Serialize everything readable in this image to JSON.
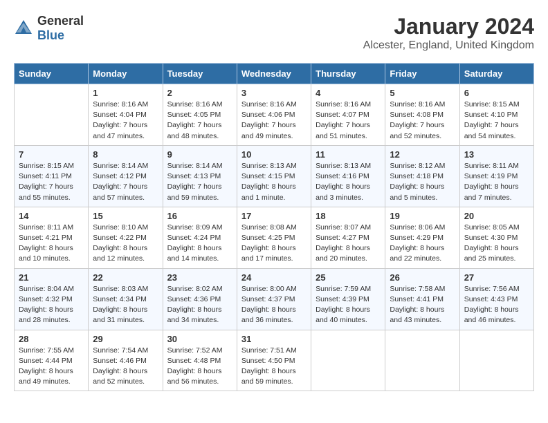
{
  "header": {
    "logo_general": "General",
    "logo_blue": "Blue",
    "month_title": "January 2024",
    "location": "Alcester, England, United Kingdom"
  },
  "days_of_week": [
    "Sunday",
    "Monday",
    "Tuesday",
    "Wednesday",
    "Thursday",
    "Friday",
    "Saturday"
  ],
  "weeks": [
    [
      {
        "day": "",
        "content": ""
      },
      {
        "day": "1",
        "content": "Sunrise: 8:16 AM\nSunset: 4:04 PM\nDaylight: 7 hours\nand 47 minutes."
      },
      {
        "day": "2",
        "content": "Sunrise: 8:16 AM\nSunset: 4:05 PM\nDaylight: 7 hours\nand 48 minutes."
      },
      {
        "day": "3",
        "content": "Sunrise: 8:16 AM\nSunset: 4:06 PM\nDaylight: 7 hours\nand 49 minutes."
      },
      {
        "day": "4",
        "content": "Sunrise: 8:16 AM\nSunset: 4:07 PM\nDaylight: 7 hours\nand 51 minutes."
      },
      {
        "day": "5",
        "content": "Sunrise: 8:16 AM\nSunset: 4:08 PM\nDaylight: 7 hours\nand 52 minutes."
      },
      {
        "day": "6",
        "content": "Sunrise: 8:15 AM\nSunset: 4:10 PM\nDaylight: 7 hours\nand 54 minutes."
      }
    ],
    [
      {
        "day": "7",
        "content": "Sunrise: 8:15 AM\nSunset: 4:11 PM\nDaylight: 7 hours\nand 55 minutes."
      },
      {
        "day": "8",
        "content": "Sunrise: 8:14 AM\nSunset: 4:12 PM\nDaylight: 7 hours\nand 57 minutes."
      },
      {
        "day": "9",
        "content": "Sunrise: 8:14 AM\nSunset: 4:13 PM\nDaylight: 7 hours\nand 59 minutes."
      },
      {
        "day": "10",
        "content": "Sunrise: 8:13 AM\nSunset: 4:15 PM\nDaylight: 8 hours\nand 1 minute."
      },
      {
        "day": "11",
        "content": "Sunrise: 8:13 AM\nSunset: 4:16 PM\nDaylight: 8 hours\nand 3 minutes."
      },
      {
        "day": "12",
        "content": "Sunrise: 8:12 AM\nSunset: 4:18 PM\nDaylight: 8 hours\nand 5 minutes."
      },
      {
        "day": "13",
        "content": "Sunrise: 8:11 AM\nSunset: 4:19 PM\nDaylight: 8 hours\nand 7 minutes."
      }
    ],
    [
      {
        "day": "14",
        "content": "Sunrise: 8:11 AM\nSunset: 4:21 PM\nDaylight: 8 hours\nand 10 minutes."
      },
      {
        "day": "15",
        "content": "Sunrise: 8:10 AM\nSunset: 4:22 PM\nDaylight: 8 hours\nand 12 minutes."
      },
      {
        "day": "16",
        "content": "Sunrise: 8:09 AM\nSunset: 4:24 PM\nDaylight: 8 hours\nand 14 minutes."
      },
      {
        "day": "17",
        "content": "Sunrise: 8:08 AM\nSunset: 4:25 PM\nDaylight: 8 hours\nand 17 minutes."
      },
      {
        "day": "18",
        "content": "Sunrise: 8:07 AM\nSunset: 4:27 PM\nDaylight: 8 hours\nand 20 minutes."
      },
      {
        "day": "19",
        "content": "Sunrise: 8:06 AM\nSunset: 4:29 PM\nDaylight: 8 hours\nand 22 minutes."
      },
      {
        "day": "20",
        "content": "Sunrise: 8:05 AM\nSunset: 4:30 PM\nDaylight: 8 hours\nand 25 minutes."
      }
    ],
    [
      {
        "day": "21",
        "content": "Sunrise: 8:04 AM\nSunset: 4:32 PM\nDaylight: 8 hours\nand 28 minutes."
      },
      {
        "day": "22",
        "content": "Sunrise: 8:03 AM\nSunset: 4:34 PM\nDaylight: 8 hours\nand 31 minutes."
      },
      {
        "day": "23",
        "content": "Sunrise: 8:02 AM\nSunset: 4:36 PM\nDaylight: 8 hours\nand 34 minutes."
      },
      {
        "day": "24",
        "content": "Sunrise: 8:00 AM\nSunset: 4:37 PM\nDaylight: 8 hours\nand 36 minutes."
      },
      {
        "day": "25",
        "content": "Sunrise: 7:59 AM\nSunset: 4:39 PM\nDaylight: 8 hours\nand 40 minutes."
      },
      {
        "day": "26",
        "content": "Sunrise: 7:58 AM\nSunset: 4:41 PM\nDaylight: 8 hours\nand 43 minutes."
      },
      {
        "day": "27",
        "content": "Sunrise: 7:56 AM\nSunset: 4:43 PM\nDaylight: 8 hours\nand 46 minutes."
      }
    ],
    [
      {
        "day": "28",
        "content": "Sunrise: 7:55 AM\nSunset: 4:44 PM\nDaylight: 8 hours\nand 49 minutes."
      },
      {
        "day": "29",
        "content": "Sunrise: 7:54 AM\nSunset: 4:46 PM\nDaylight: 8 hours\nand 52 minutes."
      },
      {
        "day": "30",
        "content": "Sunrise: 7:52 AM\nSunset: 4:48 PM\nDaylight: 8 hours\nand 56 minutes."
      },
      {
        "day": "31",
        "content": "Sunrise: 7:51 AM\nSunset: 4:50 PM\nDaylight: 8 hours\nand 59 minutes."
      },
      {
        "day": "",
        "content": ""
      },
      {
        "day": "",
        "content": ""
      },
      {
        "day": "",
        "content": ""
      }
    ]
  ]
}
